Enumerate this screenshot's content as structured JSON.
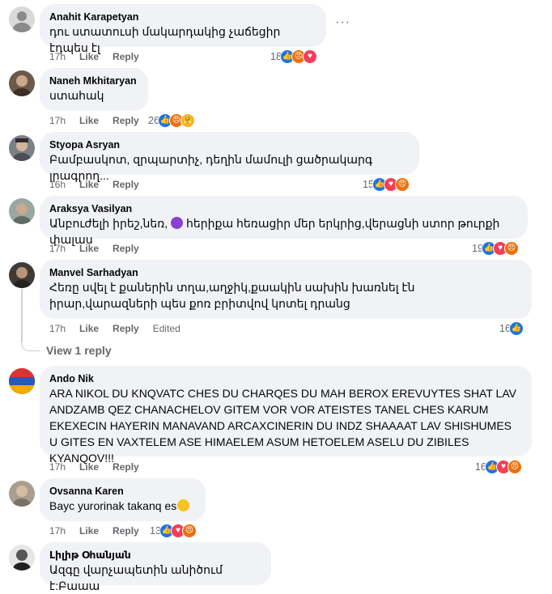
{
  "comments": [
    {
      "author": "Anahit Karapetyan",
      "text": "դու ստատուսի մակարդակից չաճեցիր էդպես էլ",
      "time": "17h",
      "like": "Like",
      "reply": "Reply",
      "reaction_count": "18",
      "reactions": [
        "like",
        "angry",
        "love"
      ],
      "menu": "···"
    },
    {
      "author": "Naneh Mkhitaryan",
      "text": "ստահակ",
      "time": "17h",
      "like": "Like",
      "reply": "Reply",
      "reaction_count": "26",
      "reactions": [
        "like",
        "angry",
        "care"
      ]
    },
    {
      "author": "Styopa Asryan",
      "text": "Բամբասկոտ, զրպարտիչ, դեղին մամուլի ցածրակարգ լրագրող...",
      "time": "16h",
      "like": "Like",
      "reply": "Reply",
      "reaction_count": "15",
      "reactions": [
        "like",
        "love",
        "angry"
      ]
    },
    {
      "author": "Araksya Vasilyan",
      "text_before_emoji": "Անբուժելի իրեշ,նեռ, ",
      "text_after_emoji": " հերիքա հեռացիր մեր երկրից,վերացնի ստոր թուրքի փալաս",
      "time": "17h",
      "like": "Like",
      "reply": "Reply",
      "reaction_count": "19",
      "reactions": [
        "like",
        "love",
        "angry"
      ]
    },
    {
      "author": "Manvel Sarhadyan",
      "text": "Հեռը սվել է քաներին տղա,աղջիկ,քաակին սախին խառնել էն իրար,վարազների պես քոռ բրիտվով կոտել դրանց",
      "time": "17h",
      "like": "Like",
      "reply": "Reply",
      "edited": "Edited",
      "reaction_count": "16",
      "reactions": [
        "like"
      ],
      "view_replies": "View 1 reply"
    },
    {
      "author": "Ando Nik",
      "text": "ARA NIKOL DU KNQVATC CHES DU CHARQES DU MAH BEROX EREVUYTES SHAT LAV ANDZAMB QEZ CHANACHELOV GITEM VOR VOR ATEISTES TANEL CHES KARUM EKEXECIN HAYERIN MANAVAND ARCAXCINERIN DU INDZ SHAAAAT LAV SHISHUMES U GITES EN VAXTELEM ASE HIMAELEM ASUM HETOELEM ASELU DU ZIBILES KYANQOV!!!",
      "time": "17h",
      "like": "Like",
      "reply": "Reply",
      "reaction_count": "16",
      "reactions": [
        "like",
        "love",
        "angry"
      ]
    },
    {
      "author": "Ovsanna Karen",
      "text": "Bayc yurorinak takanq es",
      "time": "17h",
      "like": "Like",
      "reply": "Reply",
      "reaction_count": "13",
      "reactions": [
        "like",
        "love",
        "angry"
      ]
    },
    {
      "author": "Լիլիթ Օհանյան",
      "text": "Ազգը վարչապետին անիծում է:Բաաա"
    }
  ],
  "colors": {
    "bubble": "#f0f2f5",
    "like": "#1b74e4",
    "love": "#f33e58",
    "angry": "#e9710f",
    "meta": "#65676b"
  }
}
